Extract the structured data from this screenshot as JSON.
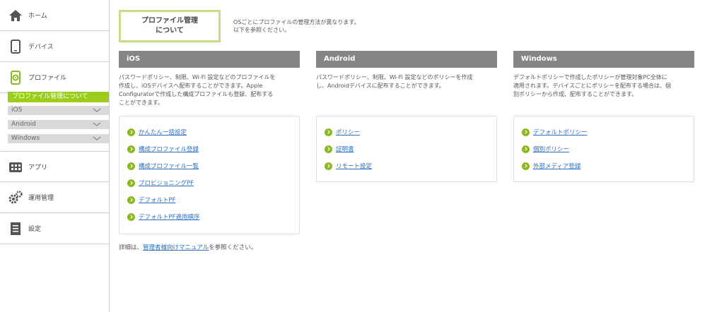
{
  "sidebar": {
    "items": [
      {
        "label": "ホーム",
        "icon": "home-icon"
      },
      {
        "label": "デバイス",
        "icon": "device-icon"
      },
      {
        "label": "プロファイル",
        "icon": "profile-gear-icon"
      },
      {
        "label": "アプリ",
        "icon": "apps-icon"
      },
      {
        "label": "運用管理",
        "icon": "gears-icon"
      },
      {
        "label": "設定",
        "icon": "settings-doc-icon"
      }
    ],
    "sub_active": "プロファイル管理について",
    "sub_items": [
      "iOS",
      "Android",
      "Windows"
    ]
  },
  "about_button": {
    "line1": "プロファイル管理",
    "line2": "について"
  },
  "intro": {
    "line1": "OSごとにプロファイルの管理方法が異なります。",
    "line2": "以下を参照ください。"
  },
  "columns": [
    {
      "title": "iOS",
      "desc": [
        "パスワードポリシー、制限、Wi-Fi 設定などのプロファイルを",
        "作成し、iOSデバイスへ配布することができます。Apple",
        "Configuratorで作成した構成プロファイルも登録、配布する",
        "ことができます。"
      ],
      "links": [
        "かんたん一括設定",
        "構成プロファイル登録",
        "構成プロファイル一覧",
        "プロビジョニングPF",
        "デフォルトPF",
        "デフォルトPF適用順序"
      ]
    },
    {
      "title": "Android",
      "desc": [
        "パスワードポリシー、制限、Wi-Fi 設定などのポリシーを作成",
        "し、Androidデバイスに配布することができます。"
      ],
      "links": [
        "ポリシー",
        "証明書",
        "リモート設定"
      ]
    },
    {
      "title": "Windows",
      "desc": [
        "デフォルトポリシーで作成したポリシーが管理対象PC全体に",
        "適用されます。デバイスごとにポリシーを配布する場合は、個",
        "別ポリシーから作成、配布することができます。"
      ],
      "links": [
        "デフォルトポリシー",
        "個別ポリシー",
        "外部メディア登録"
      ]
    }
  ],
  "footer": {
    "prefix": "詳細は、",
    "link": "管理者様向けマニュアル",
    "suffix": "を参照ください。"
  },
  "colors": {
    "accent": "#9ccd1c",
    "header": "#858585",
    "link": "#2a6fc4"
  }
}
